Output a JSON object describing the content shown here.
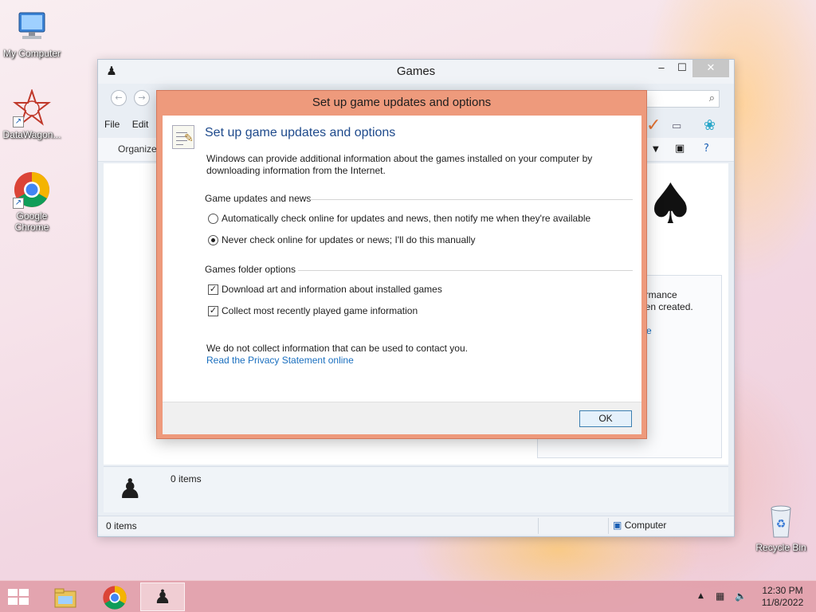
{
  "desktop": {
    "icons": [
      {
        "label": "My Computer"
      },
      {
        "label": "DataWagon..."
      },
      {
        "label": "Google Chrome"
      },
      {
        "label": "Recycle Bin"
      }
    ]
  },
  "explorer": {
    "title": "Games",
    "menu": [
      "File",
      "Edit"
    ],
    "organize_label": "Organize",
    "side_panel": {
      "line1": "ormance",
      "line2": "een created.",
      "line3": "e"
    },
    "details_text": "0 items",
    "status_left": "0 items",
    "status_right": "Computer"
  },
  "dialog": {
    "window_title": "Set up game updates and options",
    "heading": "Set up game updates and options",
    "intro": "Windows can provide additional information about the games installed on your computer by downloading information from the Internet.",
    "group1_label": "Game updates and news",
    "radio_auto_label": "Automatically check online for updates and news, then notify me when they're available",
    "radio_never_label": "Never check online for updates or news; I'll do this manually",
    "selected_radio": "never",
    "group2_label": "Games folder options",
    "check_art_label": "Download art and information about installed games",
    "check_art_checked": true,
    "check_recent_label": "Collect most recently played game information",
    "check_recent_checked": true,
    "note": "We do not collect information that can be used to contact you.",
    "privacy_link": "Read the Privacy Statement online",
    "ok_label": "OK"
  },
  "taskbar": {
    "clock_time": "12:30 PM",
    "clock_date": "11/8/2022"
  },
  "colors": {
    "dialog_frame": "#ee9a7c",
    "link": "#1a6fbf",
    "heading": "#1e4a8c"
  }
}
